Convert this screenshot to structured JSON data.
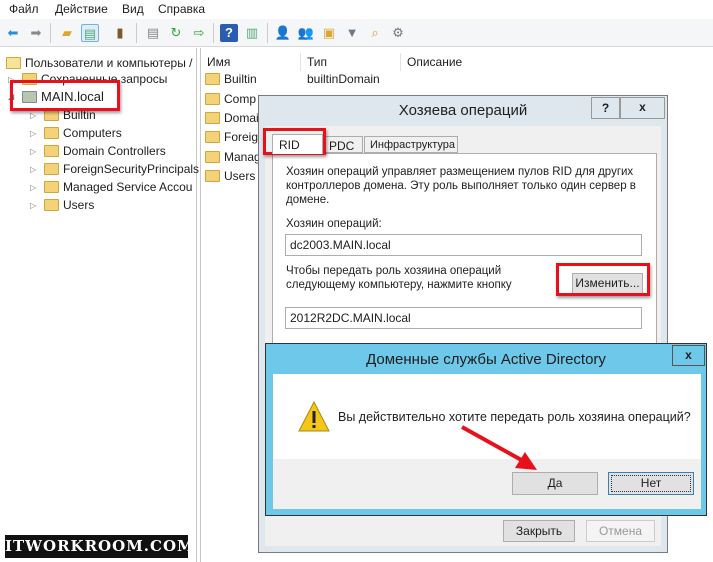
{
  "menu": [
    "Файл",
    "Действие",
    "Вид",
    "Справка"
  ],
  "toolbar_icons": [
    "back-icon",
    "forward-icon",
    "up-folder-icon",
    "show-console-tree-icon",
    "clipboard-icon",
    "properties-icon",
    "refresh-icon",
    "export-list-icon",
    "help-icon",
    "action-pane-icon",
    "new-user-icon",
    "new-group-icon",
    "new-ou-icon",
    "filter-icon",
    "find-icon",
    "add-to-group-icon"
  ],
  "tree": {
    "root": "Пользователи и компьютеры /",
    "items": [
      "Сохраненные запросы",
      "MAIN.local",
      "Builtin",
      "Computers",
      "Domain Controllers",
      "ForeignSecurityPrincipals",
      "Managed Service Accou",
      "Users"
    ]
  },
  "list": {
    "columns": [
      "Имя",
      "Тип",
      "Описание"
    ],
    "rows": [
      {
        "name": "Builtin",
        "type": "builtinDomain"
      },
      {
        "name": "Comp"
      },
      {
        "name": "Domai"
      },
      {
        "name": "Foreig"
      },
      {
        "name": "Manag"
      },
      {
        "name": "Users"
      }
    ]
  },
  "ops_dialog": {
    "title": "Хозяева операций",
    "help": "?",
    "close": "x",
    "tabs": [
      "RID",
      "PDC",
      "Инфраструктура"
    ],
    "description": "Хозяин операций управляет размещением пулов RID для других контроллеров домена. Эту роль выполняет только один сервер в домене.",
    "master_label": "Хозяин операций:",
    "master_value": "dc2003.MAIN.local",
    "transfer_text": "Чтобы передать роль хозяина операций следующему компьютеру, нажмите кнопку \"Изменить\".",
    "change_button": "Изменить...",
    "target_value": "2012R2DC.MAIN.local",
    "close_button": "Закрыть",
    "cancel_button": "Отмена"
  },
  "confirm_dialog": {
    "title": "Доменные службы Active Directory",
    "close": "x",
    "message": "Вы действительно хотите передать роль хозяина операций?",
    "yes": "Да",
    "no": "Нет",
    "icon": "warning-icon"
  },
  "watermark": "ITWORKROOM.COM",
  "colors": {
    "highlight": "#e8101a",
    "confirm_title_bar": "#6dc8ea",
    "ops_title_bar": "#dfe7ee"
  }
}
